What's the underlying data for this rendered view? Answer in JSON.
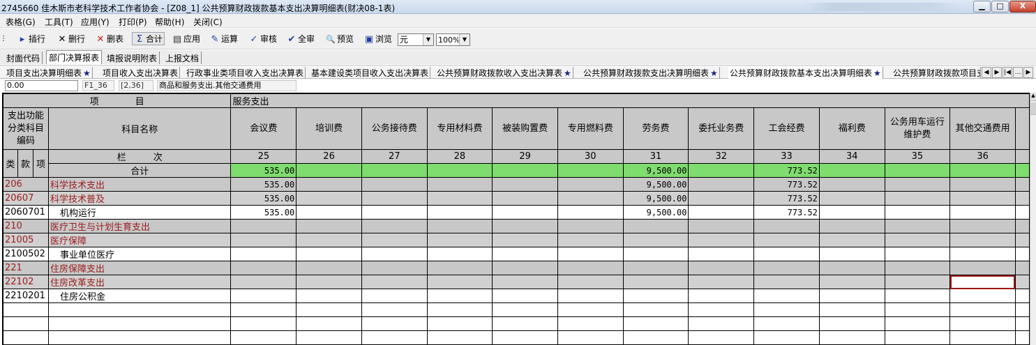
{
  "window": {
    "title": "2745660  佳木斯市老科学技术工作者协会 - [Z08_1] 公共预算财政拨款基本支出决算明细表(财决08-1表)",
    "min_btn": "▁",
    "max_btn": "□",
    "close_btn": "X"
  },
  "menu": [
    "表格(G)",
    "工具(T)",
    "应用(Y)",
    "打印(P)",
    "帮助(H)",
    "关闭(C)"
  ],
  "toolbar": {
    "items": [
      {
        "icon": "insert-row-icon",
        "glyph": "▸",
        "label": "插行"
      },
      {
        "icon": "delete-row-icon",
        "glyph": "✕",
        "label": "删行"
      },
      {
        "icon": "delete-table-icon",
        "glyph": "✕",
        "label": "删表"
      },
      {
        "icon": "sum-icon",
        "glyph": "Σ",
        "label": "合计"
      },
      {
        "icon": "apply-icon",
        "glyph": "▤",
        "label": "应用"
      },
      {
        "icon": "calculate-icon",
        "glyph": "✎",
        "label": "运算"
      },
      {
        "icon": "audit-icon",
        "glyph": "✓",
        "label": "审核"
      },
      {
        "icon": "full-audit-icon",
        "glyph": "✔",
        "label": "全审"
      },
      {
        "icon": "preview-icon",
        "glyph": "🔍",
        "label": "预览"
      },
      {
        "icon": "browse-icon",
        "glyph": "▣",
        "label": "浏览"
      }
    ],
    "unit_select": "元",
    "zoom_select": "100%"
  },
  "sheet_tabs": [
    "封面代码",
    "部门决算报表",
    "填报说明附表",
    "上报文档"
  ],
  "active_sheet_tab": 1,
  "table_tabs": [
    {
      "label": "项目支出决算明细表",
      "star": true
    },
    {
      "label": "项目收入支出决算表",
      "star": false
    },
    {
      "label": "行政事业类项目收入支出决算表",
      "star": false
    },
    {
      "label": "基本建设类项目收入支出决算表",
      "star": false
    },
    {
      "label": "公共预算财政拨款收入支出决算表",
      "star": true
    },
    {
      "label": "公共预算财政拨款支出决算明细表",
      "star": true
    },
    {
      "label": "公共预算财政拨款基本支出决算明细表",
      "star": true
    },
    {
      "label": "公共预算财政拨款项目支",
      "star": false
    }
  ],
  "formula_bar": {
    "value": "0.00",
    "cell_ref": "F1_36",
    "cell_pos": "[2,36]",
    "cell_desc": "商品和服务支出.其他交通费用"
  },
  "grid": {
    "header_project": "项　　　　目",
    "header_group": "服务支出",
    "header_code": "支出功能分类科目编码",
    "header_name": "科目名称",
    "header_col_label": "栏　　　次",
    "header_lei": "类",
    "header_kuan": "款",
    "header_xiang": "项",
    "columns": [
      {
        "name": "会议费",
        "num": "25"
      },
      {
        "name": "培训费",
        "num": "26"
      },
      {
        "name": "公务接待费",
        "num": "27"
      },
      {
        "name": "专用材料费",
        "num": "28"
      },
      {
        "name": "被装购置费",
        "num": "29"
      },
      {
        "name": "专用燃料费",
        "num": "30"
      },
      {
        "name": "劳务费",
        "num": "31"
      },
      {
        "name": "委托业务费",
        "num": "32"
      },
      {
        "name": "工会经费",
        "num": "33"
      },
      {
        "name": "福利费",
        "num": "34"
      },
      {
        "name": "公务用车运行维护费",
        "num": "35"
      },
      {
        "name": "其他交通费用",
        "num": "36"
      }
    ],
    "total_label": "合计",
    "total_values": [
      "535.00",
      "",
      "",
      "",
      "",
      "",
      "9,500.00",
      "",
      "773.52",
      "",
      "",
      ""
    ],
    "rows": [
      {
        "code": "206",
        "name": "科学技术支出",
        "style": "cat",
        "values": [
          "535.00",
          "",
          "",
          "",
          "",
          "",
          "9,500.00",
          "",
          "773.52",
          "",
          "",
          ""
        ]
      },
      {
        "code": "20607",
        "name": "科学技术普及",
        "style": "cat2",
        "values": [
          "535.00",
          "",
          "",
          "",
          "",
          "",
          "9,500.00",
          "",
          "773.52",
          "",
          "",
          ""
        ]
      },
      {
        "code": "2060701",
        "name": "机构运行",
        "style": "white",
        "values": [
          "535.00",
          "",
          "",
          "",
          "",
          "",
          "9,500.00",
          "",
          "773.52",
          "",
          "",
          ""
        ]
      },
      {
        "code": "210",
        "name": "医疗卫生与计划生育支出",
        "style": "cat",
        "values": [
          "",
          "",
          "",
          "",
          "",
          "",
          "",
          "",
          "",
          "",
          "",
          ""
        ]
      },
      {
        "code": "21005",
        "name": "医疗保障",
        "style": "cat2",
        "values": [
          "",
          "",
          "",
          "",
          "",
          "",
          "",
          "",
          "",
          "",
          "",
          ""
        ]
      },
      {
        "code": "2100502",
        "name": "事业单位医疗",
        "style": "white",
        "values": [
          "",
          "",
          "",
          "",
          "",
          "",
          "",
          "",
          "",
          "",
          "",
          ""
        ]
      },
      {
        "code": "221",
        "name": "住房保障支出",
        "style": "cat",
        "values": [
          "",
          "",
          "",
          "",
          "",
          "",
          "",
          "",
          "",
          "",
          "",
          ""
        ]
      },
      {
        "code": "22102",
        "name": "住房改革支出",
        "style": "cat2",
        "values": [
          "",
          "",
          "",
          "",
          "",
          "",
          "",
          "",
          "",
          "",
          "",
          ""
        ]
      },
      {
        "code": "2210201",
        "name": "住房公积金",
        "style": "white",
        "values": [
          "",
          "",
          "",
          "",
          "",
          "",
          "",
          "",
          "",
          "",
          "",
          ""
        ]
      }
    ],
    "empty_rows": 3
  }
}
